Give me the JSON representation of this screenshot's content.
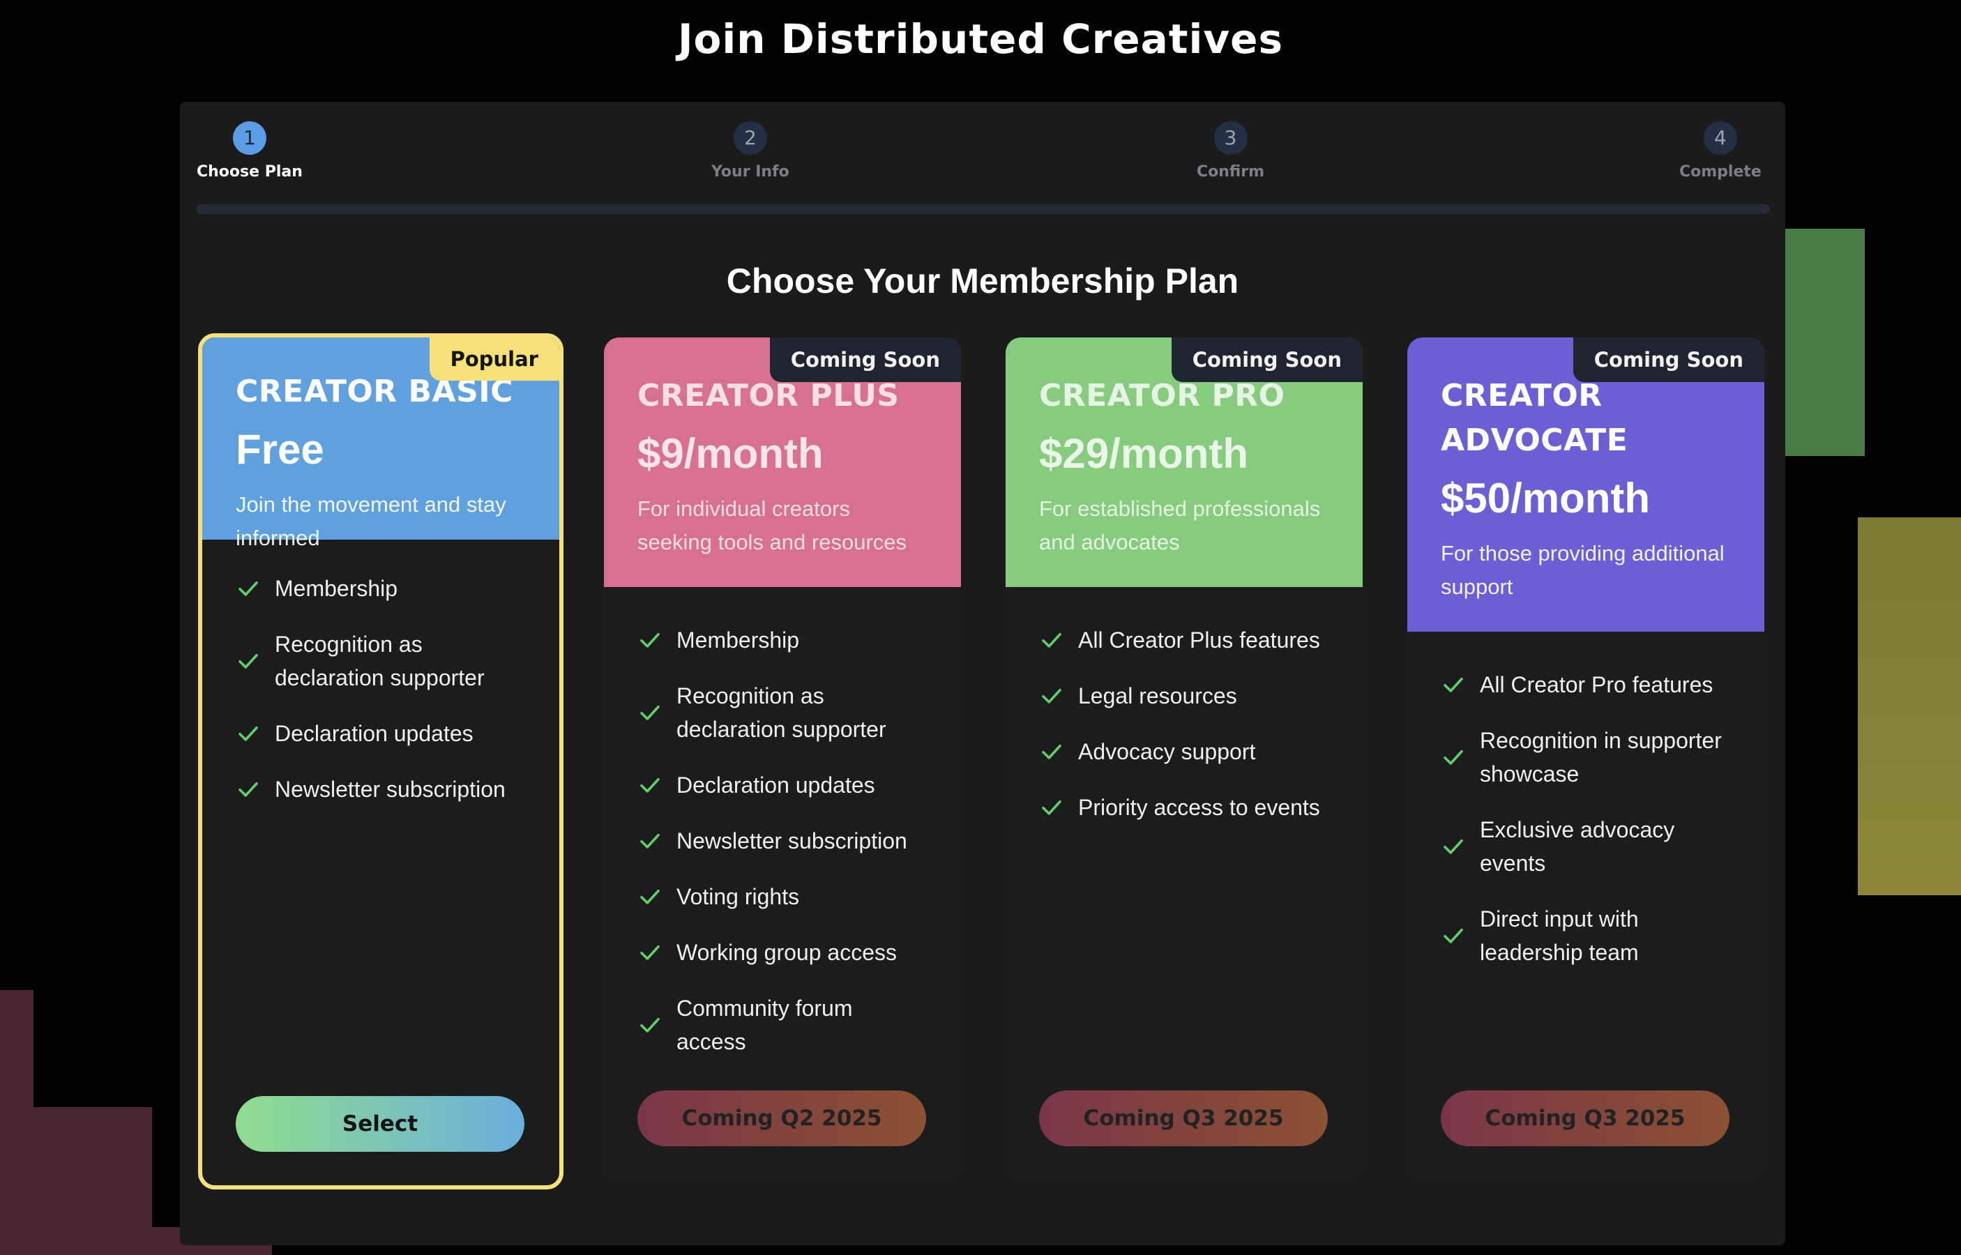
{
  "page_title": "Join Distributed Creatives",
  "stepper": {
    "steps": [
      {
        "number": "1",
        "label": "Choose Plan",
        "active": true
      },
      {
        "number": "2",
        "label": "Your Info",
        "active": false
      },
      {
        "number": "3",
        "label": "Confirm",
        "active": false
      },
      {
        "number": "4",
        "label": "Complete",
        "active": false
      }
    ]
  },
  "section_title": "Choose Your Membership Plan",
  "plans": [
    {
      "badge": "Popular",
      "name": "CREATOR BASIC",
      "price": "Free",
      "description": "Join the movement and stay informed",
      "features": [
        "Membership",
        "Recognition as declaration supporter",
        "Declaration updates",
        "Newsletter subscription"
      ],
      "button": "Select",
      "color": "#5fa0df"
    },
    {
      "badge": "Coming Soon",
      "name": "CREATOR PLUS",
      "price": "$9/month",
      "description": "For individual creators seeking tools and resources",
      "features": [
        "Membership",
        "Recognition as declaration supporter",
        "Declaration updates",
        "Newsletter subscription",
        "Voting rights",
        "Working group access",
        "Community forum access"
      ],
      "button": "Coming Q2 2025",
      "color": "#d8708f"
    },
    {
      "badge": "Coming Soon",
      "name": "CREATOR PRO",
      "price": "$29/month",
      "description": "For established professionals and advocates",
      "features": [
        "All Creator Plus features",
        "Legal resources",
        "Advocacy support",
        "Priority access to events"
      ],
      "button": "Coming Q3 2025",
      "color": "#87cc7e"
    },
    {
      "badge": "Coming Soon",
      "name": "CREATOR ADVOCATE",
      "price": "$50/month",
      "description": "For those providing additional support",
      "features": [
        "All Creator Pro features",
        "Recognition in supporter showcase",
        "Exclusive advocacy events",
        "Direct input with leadership team"
      ],
      "button": "Coming Q3 2025",
      "color": "#6b5fd6"
    }
  ],
  "icons": {
    "check": "check-icon"
  },
  "accent_colors": {
    "popular_border": "#f5e07a",
    "check": "#5fd06a",
    "active_step": "#5b9ee6"
  }
}
